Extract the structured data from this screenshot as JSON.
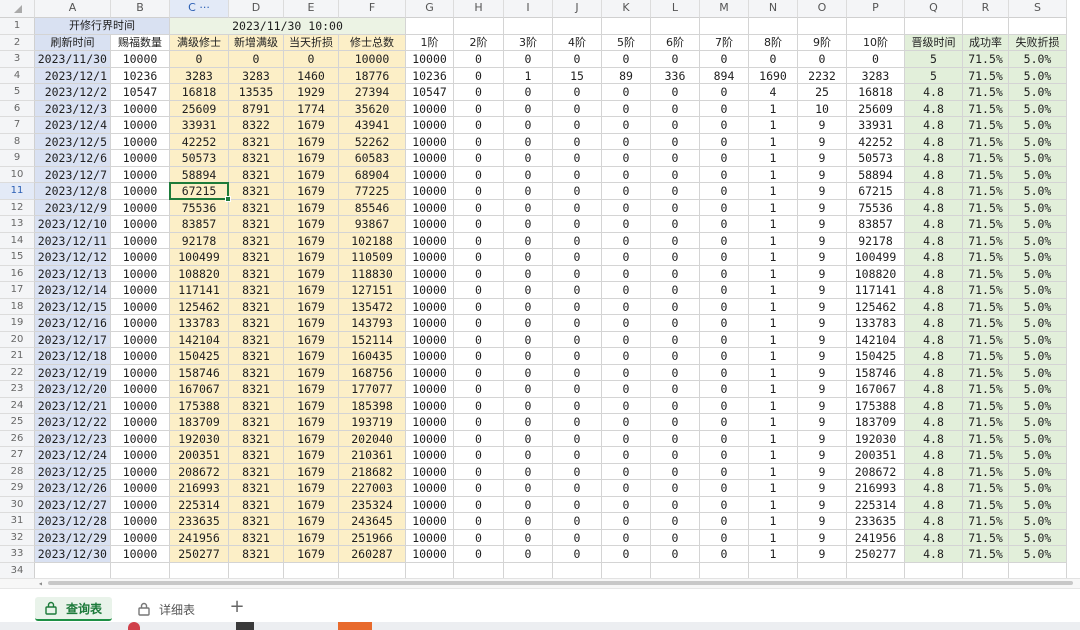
{
  "spreadsheet": {
    "corner_icon": "select-all-triangle-icon",
    "column_letters": [
      "A",
      "B",
      "C ···",
      "D",
      "E",
      "F",
      "G",
      "H",
      "I",
      "J",
      "K",
      "L",
      "M",
      "N",
      "O",
      "P",
      "Q",
      "R",
      "S"
    ],
    "row_numbers": [
      "1",
      "2",
      "3",
      "4",
      "5",
      "6",
      "7",
      "8",
      "9",
      "10",
      "11",
      "12",
      "13",
      "14",
      "15",
      "16",
      "17",
      "18",
      "19",
      "20",
      "21",
      "22",
      "23",
      "24",
      "25",
      "26",
      "27",
      "28",
      "29",
      "30",
      "31",
      "32",
      "33",
      "34"
    ],
    "active_column": "C",
    "active_row": "11",
    "title_row": {
      "label": "开修行界时间",
      "value": "2023/11/30 10:00"
    },
    "headers": [
      "刷新时间",
      "赐福数量",
      "满级修士",
      "新增满级",
      "当天折损",
      "修士总数",
      "1阶",
      "2阶",
      "3阶",
      "4阶",
      "5阶",
      "6阶",
      "7阶",
      "8阶",
      "9阶",
      "10阶",
      "晋级时间",
      "成功率",
      "失败折损"
    ],
    "rows": [
      [
        "2023/11/30",
        "10000",
        "0",
        "0",
        "0",
        "10000",
        "10000",
        "0",
        "0",
        "0",
        "0",
        "0",
        "0",
        "0",
        "0",
        "0",
        "5",
        "71.5%",
        "5.0%"
      ],
      [
        "2023/12/1",
        "10236",
        "3283",
        "3283",
        "1460",
        "18776",
        "10236",
        "0",
        "1",
        "15",
        "89",
        "336",
        "894",
        "1690",
        "2232",
        "3283",
        "5",
        "71.5%",
        "5.0%"
      ],
      [
        "2023/12/2",
        "10547",
        "16818",
        "13535",
        "1929",
        "27394",
        "10547",
        "0",
        "0",
        "0",
        "0",
        "0",
        "0",
        "4",
        "25",
        "16818",
        "4.8",
        "71.5%",
        "5.0%"
      ],
      [
        "2023/12/3",
        "10000",
        "25609",
        "8791",
        "1774",
        "35620",
        "10000",
        "0",
        "0",
        "0",
        "0",
        "0",
        "0",
        "1",
        "10",
        "25609",
        "4.8",
        "71.5%",
        "5.0%"
      ],
      [
        "2023/12/4",
        "10000",
        "33931",
        "8322",
        "1679",
        "43941",
        "10000",
        "0",
        "0",
        "0",
        "0",
        "0",
        "0",
        "1",
        "9",
        "33931",
        "4.8",
        "71.5%",
        "5.0%"
      ],
      [
        "2023/12/5",
        "10000",
        "42252",
        "8321",
        "1679",
        "52262",
        "10000",
        "0",
        "0",
        "0",
        "0",
        "0",
        "0",
        "1",
        "9",
        "42252",
        "4.8",
        "71.5%",
        "5.0%"
      ],
      [
        "2023/12/6",
        "10000",
        "50573",
        "8321",
        "1679",
        "60583",
        "10000",
        "0",
        "0",
        "0",
        "0",
        "0",
        "0",
        "1",
        "9",
        "50573",
        "4.8",
        "71.5%",
        "5.0%"
      ],
      [
        "2023/12/7",
        "10000",
        "58894",
        "8321",
        "1679",
        "68904",
        "10000",
        "0",
        "0",
        "0",
        "0",
        "0",
        "0",
        "1",
        "9",
        "58894",
        "4.8",
        "71.5%",
        "5.0%"
      ],
      [
        "2023/12/8",
        "10000",
        "67215",
        "8321",
        "1679",
        "77225",
        "10000",
        "0",
        "0",
        "0",
        "0",
        "0",
        "0",
        "1",
        "9",
        "67215",
        "4.8",
        "71.5%",
        "5.0%"
      ],
      [
        "2023/12/9",
        "10000",
        "75536",
        "8321",
        "1679",
        "85546",
        "10000",
        "0",
        "0",
        "0",
        "0",
        "0",
        "0",
        "1",
        "9",
        "75536",
        "4.8",
        "71.5%",
        "5.0%"
      ],
      [
        "2023/12/10",
        "10000",
        "83857",
        "8321",
        "1679",
        "93867",
        "10000",
        "0",
        "0",
        "0",
        "0",
        "0",
        "0",
        "1",
        "9",
        "83857",
        "4.8",
        "71.5%",
        "5.0%"
      ],
      [
        "2023/12/11",
        "10000",
        "92178",
        "8321",
        "1679",
        "102188",
        "10000",
        "0",
        "0",
        "0",
        "0",
        "0",
        "0",
        "1",
        "9",
        "92178",
        "4.8",
        "71.5%",
        "5.0%"
      ],
      [
        "2023/12/12",
        "10000",
        "100499",
        "8321",
        "1679",
        "110509",
        "10000",
        "0",
        "0",
        "0",
        "0",
        "0",
        "0",
        "1",
        "9",
        "100499",
        "4.8",
        "71.5%",
        "5.0%"
      ],
      [
        "2023/12/13",
        "10000",
        "108820",
        "8321",
        "1679",
        "118830",
        "10000",
        "0",
        "0",
        "0",
        "0",
        "0",
        "0",
        "1",
        "9",
        "108820",
        "4.8",
        "71.5%",
        "5.0%"
      ],
      [
        "2023/12/14",
        "10000",
        "117141",
        "8321",
        "1679",
        "127151",
        "10000",
        "0",
        "0",
        "0",
        "0",
        "0",
        "0",
        "1",
        "9",
        "117141",
        "4.8",
        "71.5%",
        "5.0%"
      ],
      [
        "2023/12/15",
        "10000",
        "125462",
        "8321",
        "1679",
        "135472",
        "10000",
        "0",
        "0",
        "0",
        "0",
        "0",
        "0",
        "1",
        "9",
        "125462",
        "4.8",
        "71.5%",
        "5.0%"
      ],
      [
        "2023/12/16",
        "10000",
        "133783",
        "8321",
        "1679",
        "143793",
        "10000",
        "0",
        "0",
        "0",
        "0",
        "0",
        "0",
        "1",
        "9",
        "133783",
        "4.8",
        "71.5%",
        "5.0%"
      ],
      [
        "2023/12/17",
        "10000",
        "142104",
        "8321",
        "1679",
        "152114",
        "10000",
        "0",
        "0",
        "0",
        "0",
        "0",
        "0",
        "1",
        "9",
        "142104",
        "4.8",
        "71.5%",
        "5.0%"
      ],
      [
        "2023/12/18",
        "10000",
        "150425",
        "8321",
        "1679",
        "160435",
        "10000",
        "0",
        "0",
        "0",
        "0",
        "0",
        "0",
        "1",
        "9",
        "150425",
        "4.8",
        "71.5%",
        "5.0%"
      ],
      [
        "2023/12/19",
        "10000",
        "158746",
        "8321",
        "1679",
        "168756",
        "10000",
        "0",
        "0",
        "0",
        "0",
        "0",
        "0",
        "1",
        "9",
        "158746",
        "4.8",
        "71.5%",
        "5.0%"
      ],
      [
        "2023/12/20",
        "10000",
        "167067",
        "8321",
        "1679",
        "177077",
        "10000",
        "0",
        "0",
        "0",
        "0",
        "0",
        "0",
        "1",
        "9",
        "167067",
        "4.8",
        "71.5%",
        "5.0%"
      ],
      [
        "2023/12/21",
        "10000",
        "175388",
        "8321",
        "1679",
        "185398",
        "10000",
        "0",
        "0",
        "0",
        "0",
        "0",
        "0",
        "1",
        "9",
        "175388",
        "4.8",
        "71.5%",
        "5.0%"
      ],
      [
        "2023/12/22",
        "10000",
        "183709",
        "8321",
        "1679",
        "193719",
        "10000",
        "0",
        "0",
        "0",
        "0",
        "0",
        "0",
        "1",
        "9",
        "183709",
        "4.8",
        "71.5%",
        "5.0%"
      ],
      [
        "2023/12/23",
        "10000",
        "192030",
        "8321",
        "1679",
        "202040",
        "10000",
        "0",
        "0",
        "0",
        "0",
        "0",
        "0",
        "1",
        "9",
        "192030",
        "4.8",
        "71.5%",
        "5.0%"
      ],
      [
        "2023/12/24",
        "10000",
        "200351",
        "8321",
        "1679",
        "210361",
        "10000",
        "0",
        "0",
        "0",
        "0",
        "0",
        "0",
        "1",
        "9",
        "200351",
        "4.8",
        "71.5%",
        "5.0%"
      ],
      [
        "2023/12/25",
        "10000",
        "208672",
        "8321",
        "1679",
        "218682",
        "10000",
        "0",
        "0",
        "0",
        "0",
        "0",
        "0",
        "1",
        "9",
        "208672",
        "4.8",
        "71.5%",
        "5.0%"
      ],
      [
        "2023/12/26",
        "10000",
        "216993",
        "8321",
        "1679",
        "227003",
        "10000",
        "0",
        "0",
        "0",
        "0",
        "0",
        "0",
        "1",
        "9",
        "216993",
        "4.8",
        "71.5%",
        "5.0%"
      ],
      [
        "2023/12/27",
        "10000",
        "225314",
        "8321",
        "1679",
        "235324",
        "10000",
        "0",
        "0",
        "0",
        "0",
        "0",
        "0",
        "1",
        "9",
        "225314",
        "4.8",
        "71.5%",
        "5.0%"
      ],
      [
        "2023/12/28",
        "10000",
        "233635",
        "8321",
        "1679",
        "243645",
        "10000",
        "0",
        "0",
        "0",
        "0",
        "0",
        "0",
        "1",
        "9",
        "233635",
        "4.8",
        "71.5%",
        "5.0%"
      ],
      [
        "2023/12/29",
        "10000",
        "241956",
        "8321",
        "1679",
        "251966",
        "10000",
        "0",
        "0",
        "0",
        "0",
        "0",
        "0",
        "1",
        "9",
        "241956",
        "4.8",
        "71.5%",
        "5.0%"
      ],
      [
        "2023/12/30",
        "10000",
        "250277",
        "8321",
        "1679",
        "260287",
        "10000",
        "0",
        "0",
        "0",
        "0",
        "0",
        "0",
        "1",
        "9",
        "250277",
        "4.8",
        "71.5%",
        "5.0%"
      ]
    ],
    "colors": {
      "date_column": "#d9e1f2",
      "orange_columns": "#fcefc7",
      "green_columns": "#e2efda",
      "title_right": "#ecf3e4",
      "selection": "#1e7b3a"
    }
  },
  "sheet_tabs": [
    {
      "label": "查询表",
      "icon": "lock-icon",
      "active": true
    },
    {
      "label": "详细表",
      "icon": "lock-icon",
      "active": false
    }
  ],
  "add_sheet_label": "+",
  "scroll_left_label": "◂"
}
